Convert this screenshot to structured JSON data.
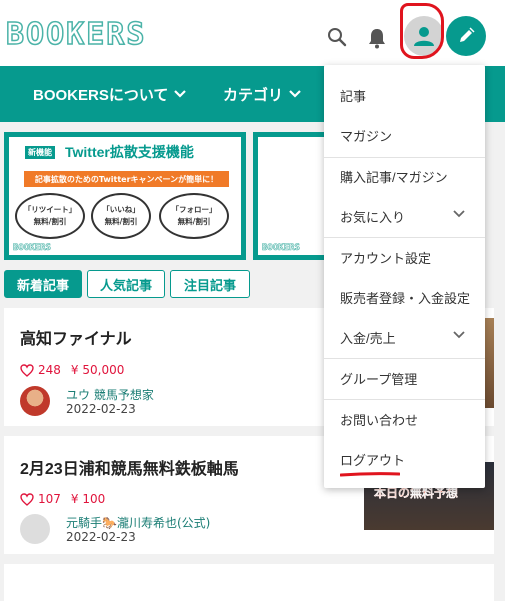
{
  "header": {
    "logo": "BOOKERS"
  },
  "nav": {
    "items": [
      {
        "label": "BOOKERSについて"
      },
      {
        "label": "カテゴリ"
      }
    ]
  },
  "banner": {
    "badge": "新機能",
    "title": "Twitter拡散支援機能",
    "subtitle": "記事拡散のためのTwitterキャンペーンが簡単に！",
    "bubbles": [
      {
        "line1": "「リツイート」",
        "line2": "無料/割引"
      },
      {
        "line1": "「いいね」",
        "line2": "無料/割引"
      },
      {
        "line1": "「フォロー」",
        "line2": "無料/割引"
      }
    ],
    "footer_logo": "BOOKERS",
    "footer_logo_2": "BOOKERS"
  },
  "tabs": [
    {
      "label": "新着記事"
    },
    {
      "label": "人気記事"
    },
    {
      "label": "注目記事"
    }
  ],
  "articles": [
    {
      "title": "高知ファイナル",
      "likes": "248",
      "price": "¥ 50,000",
      "author": "ユウ 競馬予想家",
      "date": "2022-02-23"
    },
    {
      "title": "2月23日浦和競馬無料鉄板軸馬",
      "likes": "107",
      "price": "¥ 100",
      "author": "元騎手🐎瀧川寿希也(公式)",
      "date": "2022-02-23",
      "thumb_text": "本日の無料予想"
    }
  ],
  "dropdown": {
    "items": [
      {
        "label": "記事"
      },
      {
        "label": "マガジン"
      },
      {
        "label": "購入記事/マガジン"
      },
      {
        "label": "お気に入り"
      },
      {
        "label": "アカウント設定"
      },
      {
        "label": "販売者登録・入金設定"
      },
      {
        "label": "入金/売上"
      },
      {
        "label": "グループ管理"
      },
      {
        "label": "お問い合わせ"
      },
      {
        "label": "ログアウト"
      }
    ]
  },
  "colors": {
    "brand": "#069a8e",
    "like": "#e0143c",
    "annotation": "#e0141e"
  }
}
